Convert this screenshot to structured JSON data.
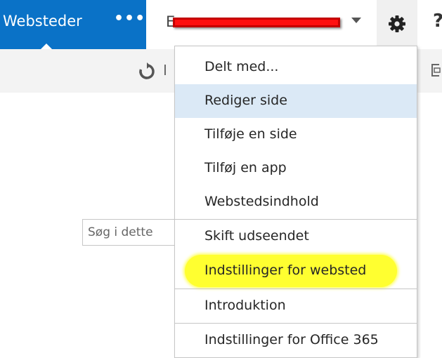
{
  "suitebar": {
    "site_label": "Websteder",
    "more_label": "•••",
    "user_initial": "E",
    "gear_icon": "gear-icon",
    "help_label": "?"
  },
  "ribbon": {
    "sync_icon": "sync-icon",
    "left_letter": "I",
    "focus_icon": "focus-icon"
  },
  "search": {
    "placeholder": "Søg i dette"
  },
  "menu": {
    "items": [
      {
        "label": "Delt med..."
      },
      {
        "label": "Rediger side",
        "selected": true
      },
      {
        "label": "Tilføje en side"
      },
      {
        "label": "Tilføj en app"
      },
      {
        "label": "Webstedsindhold"
      },
      {
        "label": "Skift udseendet"
      },
      {
        "label": "Indstillinger for websted",
        "highlighted": true
      },
      {
        "label": "Introduktion"
      },
      {
        "label": "Indstillinger for Office 365"
      }
    ]
  },
  "colors": {
    "suitebar_blue": "#0a72c7",
    "selected_item": "#dbe9f6",
    "highlight": "#ffff30",
    "redaction": "#ff1010"
  }
}
